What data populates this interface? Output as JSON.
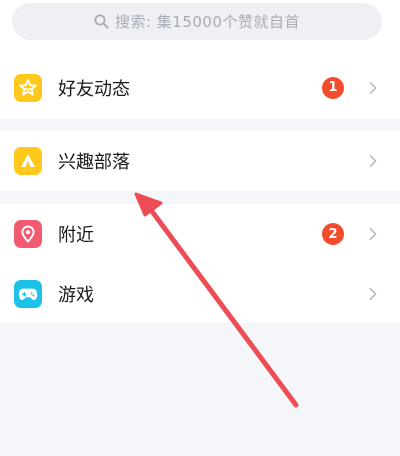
{
  "search": {
    "placeholder": "搜索: 集15000个赞就自首",
    "icon": "search-icon"
  },
  "list": {
    "friend_feed": {
      "label": "好友动态",
      "badge": "1",
      "icon": "star-icon"
    },
    "interest_tribe": {
      "label": "兴趣部落",
      "icon": "tent-icon"
    },
    "nearby": {
      "label": "附近",
      "badge": "2",
      "icon": "location-pin-icon"
    },
    "games": {
      "label": "游戏",
      "icon": "gamepad-icon"
    }
  },
  "colors": {
    "badge": "#f24c2d",
    "annotation_arrow": "#ee4d55",
    "icon_yellow": "#ffc81a",
    "icon_pink": "#f25b6f",
    "icon_cyan": "#1cc2e8"
  }
}
